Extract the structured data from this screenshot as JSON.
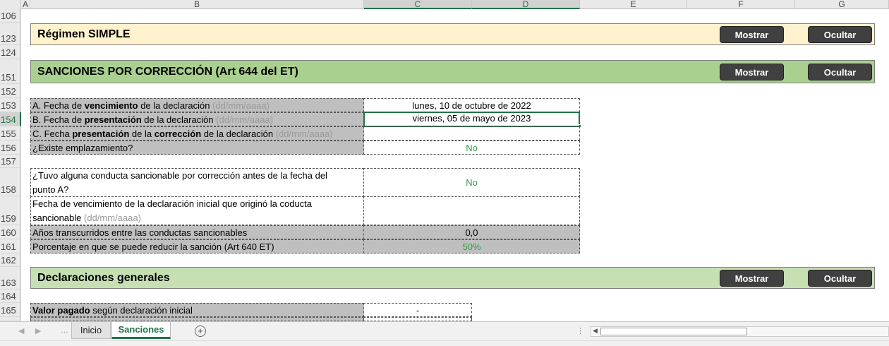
{
  "columns": [
    "A",
    "B",
    "C",
    "D",
    "E",
    "F",
    "G"
  ],
  "rows": {
    "r106": "106",
    "r123": "123",
    "r124": "124",
    "r151": "151",
    "r152": "152",
    "r153": "153",
    "r154": "154",
    "r155": "155",
    "r156": "156",
    "r157": "157",
    "r158": "158",
    "r159": "159",
    "r160": "160",
    "r161": "161",
    "r162": "162",
    "r163": "163",
    "r164": "164",
    "r165": "165"
  },
  "banners": {
    "simple": {
      "title": "Régimen SIMPLE",
      "show": "Mostrar",
      "hide": "Ocultar",
      "color": "#fff2cc"
    },
    "sanciones": {
      "title": "SANCIONES POR CORRECCIÓN (Art 644 del ET)",
      "show": "Mostrar",
      "hide": "Ocultar",
      "color": "#a9d08e"
    },
    "generales": {
      "title": "Declaraciones generales",
      "show": "Mostrar",
      "hide": "Ocultar",
      "color": "#c6e0b4"
    }
  },
  "fields": {
    "a_label_pre": "A. Fecha de ",
    "a_label_bold": "vencimiento",
    "a_label_post": " de la declaración ",
    "a_hint": "(dd/mm/aaaa)",
    "a_value": "lunes, 10 de octubre de 2022",
    "b_label_pre": "B. Fecha de ",
    "b_label_bold": "presentación",
    "b_label_post": " de la declaración ",
    "b_hint": "(dd/mm/aaaa)",
    "b_value": "viernes, 05 de mayo de 2023",
    "c_label_pre": "C. Fecha ",
    "c_label_bold1": "presentación",
    "c_label_mid": " de la ",
    "c_label_bold2": "corrección",
    "c_label_post": " de la declaración ",
    "c_hint": "(dd/mm/aaaa)",
    "c_value": "",
    "emplaz_label": "¿Existe emplazamiento?",
    "emplaz_value": "No",
    "conducta_label_1": "¿Tuvo alguna conducta sancionable por corrección antes de la fecha del",
    "conducta_label_2": "punto A?",
    "conducta_value": "No",
    "venc_inicial_label_1": "Fecha de vencimiento de la declaración inicial que originó la coducta",
    "venc_inicial_label_2": "sancionable ",
    "venc_inicial_hint": "(dd/mm/aaaa)",
    "venc_inicial_value": "",
    "anios_label": "Años transcurridos entre las conductas sancionables",
    "anios_value": "0,0",
    "porc_label": " Porcentaje en que se puede reducir la sanción (Art 640 ET)",
    "porc_value": "50%",
    "valor_label_bold": "Valor pagado",
    "valor_label_post": " según declaración inicial",
    "valor_value": "-"
  },
  "sheet_tabs": {
    "inicio": "Inicio",
    "sanciones": "Sanciones",
    "add": "+"
  },
  "colors": {
    "accent": "#217346",
    "green_text": "#2e9c4a",
    "gray_cell": "#bfbfbf"
  }
}
